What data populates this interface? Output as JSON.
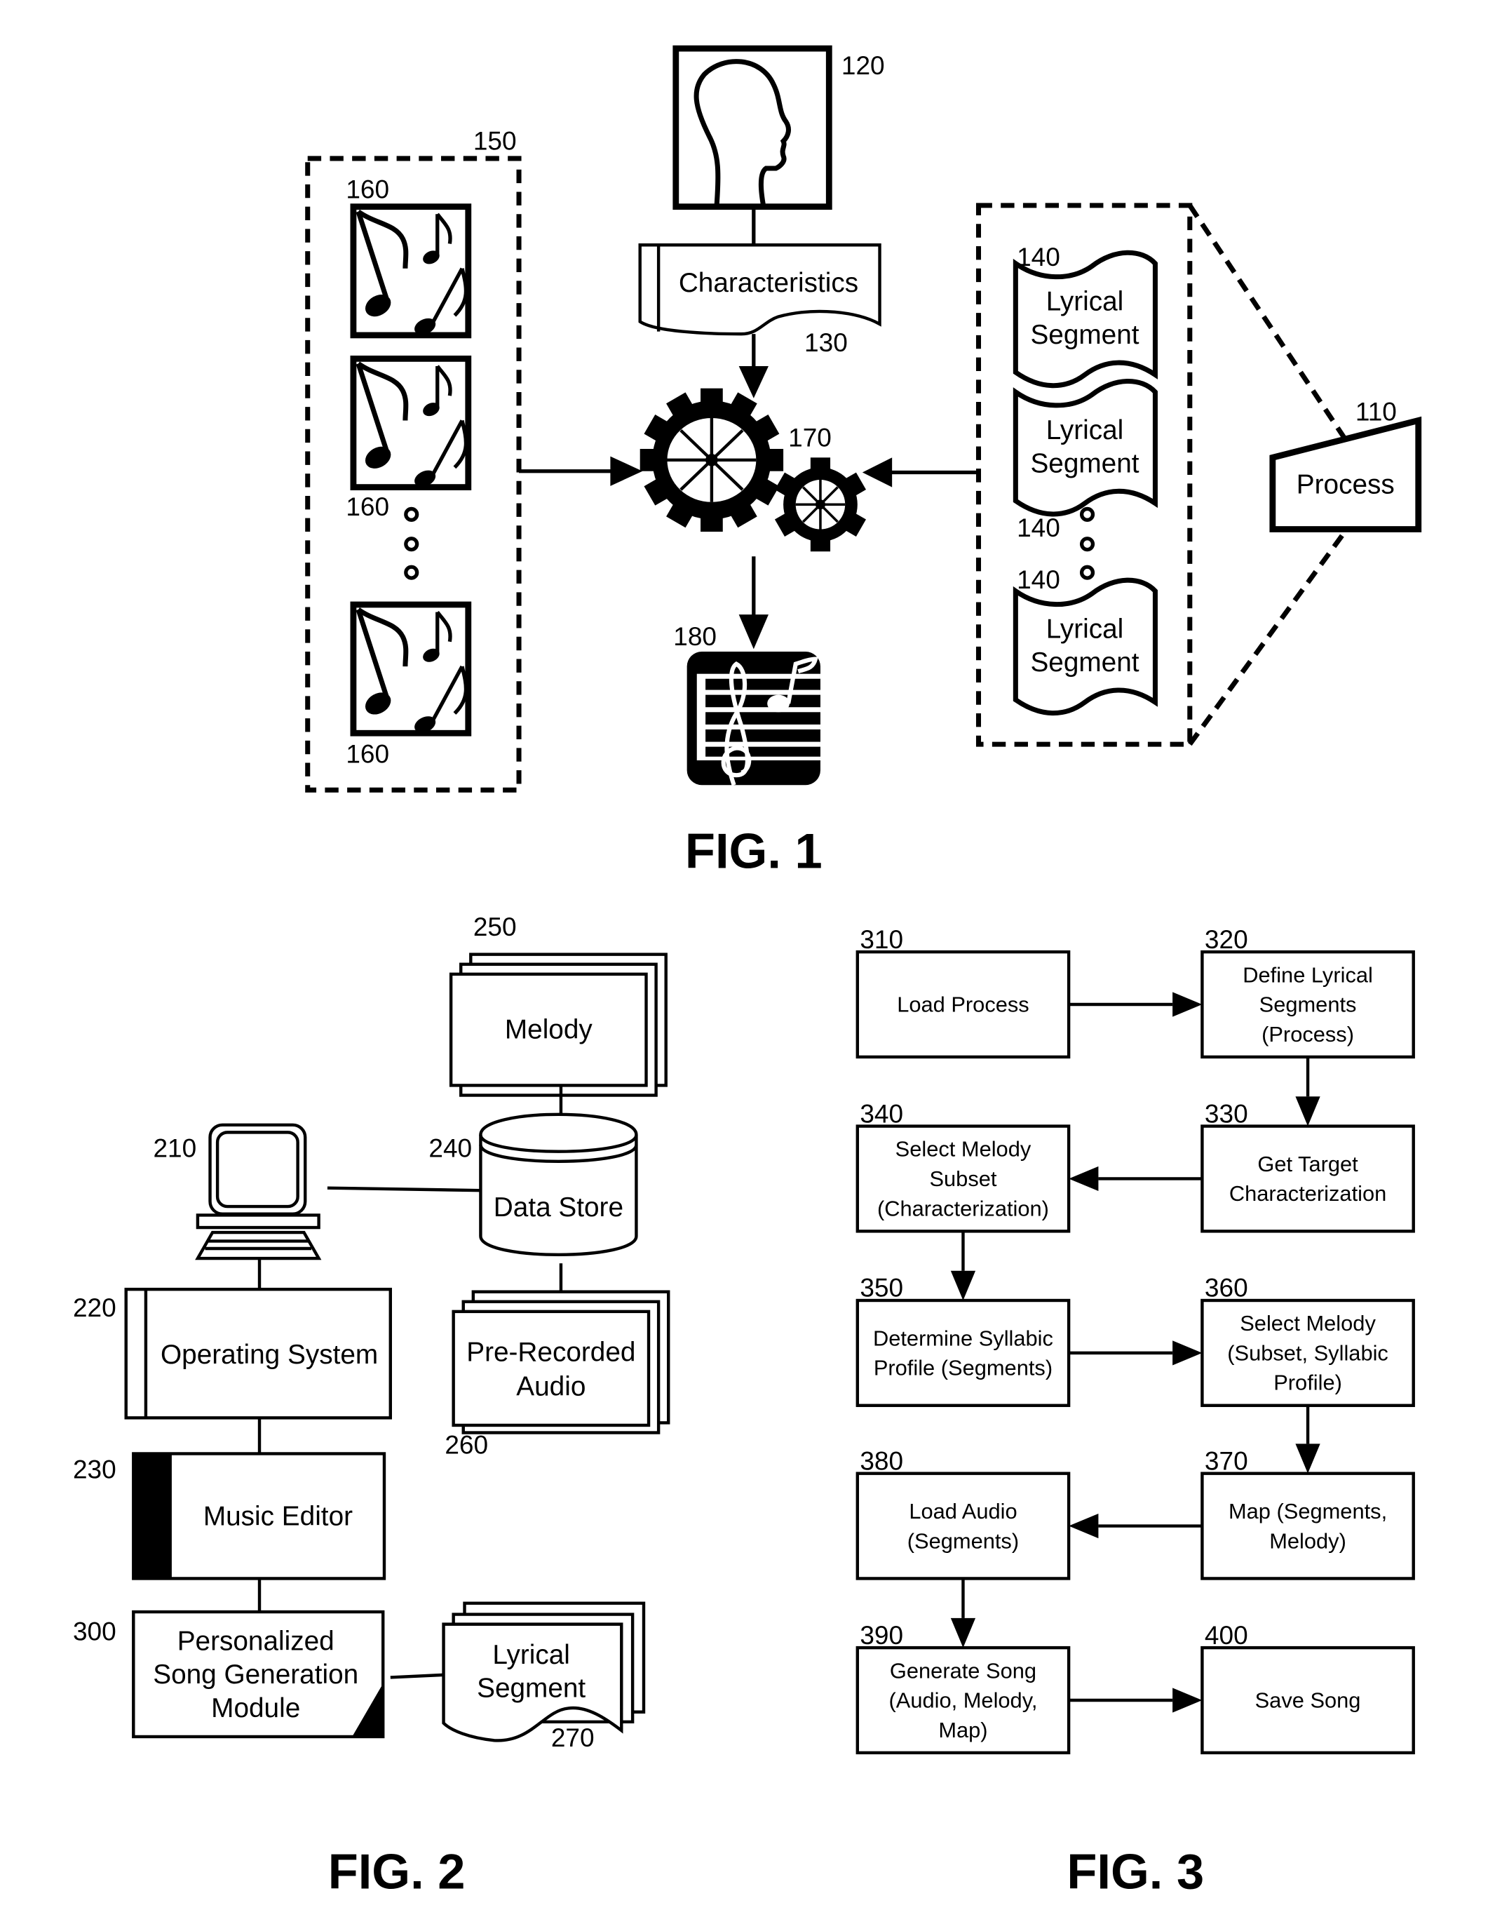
{
  "fig1": {
    "caption": "FIG. 1",
    "person": {
      "ref": "120"
    },
    "characteristics": {
      "label": "Characteristics",
      "ref": "130"
    },
    "melody_collection": {
      "ref": "150",
      "item_refs": [
        "160",
        "160",
        "160"
      ],
      "item_icon": "music-notes-icon"
    },
    "engine": {
      "ref": "170",
      "icon": "gears-icon"
    },
    "output_song": {
      "ref": "180",
      "icon": "sheet-music-icon"
    },
    "lyrical_collection": {
      "item_label_line1": "Lyrical",
      "item_label_line2": "Segment",
      "item_refs": [
        "140",
        "140",
        "140"
      ]
    },
    "process": {
      "label": "Process",
      "ref": "110"
    }
  },
  "fig2": {
    "caption": "FIG. 2",
    "computer": {
      "ref": "210",
      "icon": "computer-icon"
    },
    "operating_system": {
      "label": "Operating System",
      "ref": "220"
    },
    "music_editor": {
      "label": "Music Editor",
      "ref": "230"
    },
    "data_store": {
      "label": "Data Store",
      "ref": "240"
    },
    "melody": {
      "label": "Melody",
      "ref": "250"
    },
    "prerecorded_audio": {
      "label_line1": "Pre-Recorded",
      "label_line2": "Audio",
      "ref": "260"
    },
    "lyrical_segment": {
      "label_line1": "Lyrical",
      "label_line2": "Segment",
      "ref": "270"
    },
    "song_module": {
      "label_line1": "Personalized",
      "label_line2": "Song Generation",
      "label_line3": "Module",
      "ref": "300"
    }
  },
  "fig3": {
    "caption": "FIG. 3",
    "steps": [
      {
        "ref": "310",
        "lines": [
          "Load Process"
        ]
      },
      {
        "ref": "320",
        "lines": [
          "Define Lyrical",
          "Segments",
          "(Process)"
        ]
      },
      {
        "ref": "330",
        "lines": [
          "Get Target",
          "Characterization"
        ]
      },
      {
        "ref": "340",
        "lines": [
          "Select Melody",
          "Subset",
          "(Characterization)"
        ]
      },
      {
        "ref": "350",
        "lines": [
          "Determine Syllabic",
          "Profile (Segments)"
        ]
      },
      {
        "ref": "360",
        "lines": [
          "Select Melody",
          "(Subset, Syllabic",
          "Profile)"
        ]
      },
      {
        "ref": "370",
        "lines": [
          "Map (Segments,",
          "Melody)"
        ]
      },
      {
        "ref": "380",
        "lines": [
          "Load Audio",
          "(Segments)"
        ]
      },
      {
        "ref": "390",
        "lines": [
          "Generate Song",
          "(Audio, Melody,",
          "Map)"
        ]
      },
      {
        "ref": "400",
        "lines": [
          "Save Song"
        ]
      }
    ]
  }
}
